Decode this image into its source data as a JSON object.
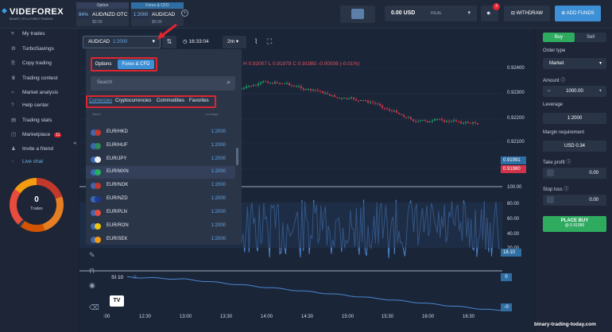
{
  "header": {
    "logo": "VIDEFOREX",
    "logo_sub": "BINARY, CFD & FOREX TRADING",
    "tabs": [
      {
        "category": "Option",
        "pct": "84%",
        "pair": "AUD/NZD OTC",
        "amount": "$0.00"
      },
      {
        "category": "Forex & CFD",
        "pct": "1:2000",
        "pair": "AUD/CAD",
        "amount": "$0.00"
      }
    ],
    "add_tab": "+",
    "balance": "0.00 USD",
    "balance_type": "REAL",
    "notif_count": "3",
    "withdraw": "WITHDRAW",
    "add_funds": "ADD FUNDS"
  },
  "sidebar": {
    "items": [
      {
        "label": "My trades",
        "icon": "≡"
      },
      {
        "label": "TurboSavings",
        "icon": "⚙"
      },
      {
        "label": "Copy trading",
        "icon": "⎘"
      },
      {
        "label": "Trading contest",
        "icon": "♛"
      },
      {
        "label": "Market analysis",
        "icon": "⌁"
      },
      {
        "label": "Help center",
        "icon": "?"
      },
      {
        "label": "Trading stats",
        "icon": "▤"
      },
      {
        "label": "Marketplace",
        "icon": "◫",
        "badge": "11"
      },
      {
        "label": "Invite a friend",
        "icon": "♟"
      },
      {
        "label": "Live chat",
        "icon": "◌"
      }
    ],
    "trades_count": "0",
    "trades_label": "Trades"
  },
  "toolbar": {
    "asset": "AUD/CAD",
    "leverage": "1:2000",
    "clock": "16:33:04",
    "timeframe": "2m"
  },
  "ohlc": "H 0.92007  L 0.91978  C 0.91980  -0.00008 (-0.01%)",
  "dropdown": {
    "mode_tabs": [
      "Options",
      "Forex & CFD"
    ],
    "search_placeholder": "Search",
    "categories": [
      "Currencies",
      "Cryptocurrencies",
      "Commodities",
      "Favorites"
    ],
    "col_name": "Name",
    "col_lev": "Leverage",
    "rows": [
      {
        "name": "EUR/HKD",
        "lev": "1:2000"
      },
      {
        "name": "EUR/HUF",
        "lev": "1:2000"
      },
      {
        "name": "EUR/JPY",
        "lev": "1:2000"
      },
      {
        "name": "EUR/MXN",
        "lev": "1:2000"
      },
      {
        "name": "EUR/NOK",
        "lev": "1:2000"
      },
      {
        "name": "EUR/NZD",
        "lev": "1:2000"
      },
      {
        "name": "EUR/PLN",
        "lev": "1:2000"
      },
      {
        "name": "EUR/RON",
        "lev": "1:2000"
      },
      {
        "name": "EUR/SEK",
        "lev": "1:2000"
      }
    ]
  },
  "chart": {
    "price_labels": [
      "0.92400",
      "0.92300",
      "0.92200",
      "0.92100",
      "0.91991",
      "0.91980"
    ],
    "osc_labels": [
      "100.00",
      "80.00",
      "60.00",
      "40.00",
      "20.00",
      "18.10"
    ],
    "rsi_label": "SI 10",
    "rsi_val": "0",
    "low_val": "-0",
    "times": [
      ":00",
      "12:30",
      "13:00",
      "13:30",
      "14:00",
      "14:30",
      "15:00",
      "15:30",
      "16:00",
      "16:30"
    ]
  },
  "right_panel": {
    "buy": "Buy",
    "sell": "Sell",
    "order_type_label": "Order type",
    "order_type": "Market",
    "amount_label": "Amount",
    "amount": "1000.00",
    "leverage_label": "Leverage",
    "leverage": "1:2000",
    "margin_label": "Margin requirement",
    "margin": "USD 0.34",
    "take_profit_label": "Take profit",
    "take_profit": "0.00",
    "stop_loss_label": "Stop loss",
    "stop_loss": "0.00",
    "place_buy": "PLACE BUY",
    "place_buy_price": "@ 0.91980"
  },
  "watermark": "binary-trading-today.com",
  "colors": {
    "accent": "#3d8fd6",
    "green": "#2eab5f",
    "red": "#e0252f",
    "up": "#1fa36b",
    "down": "#d1344a"
  }
}
